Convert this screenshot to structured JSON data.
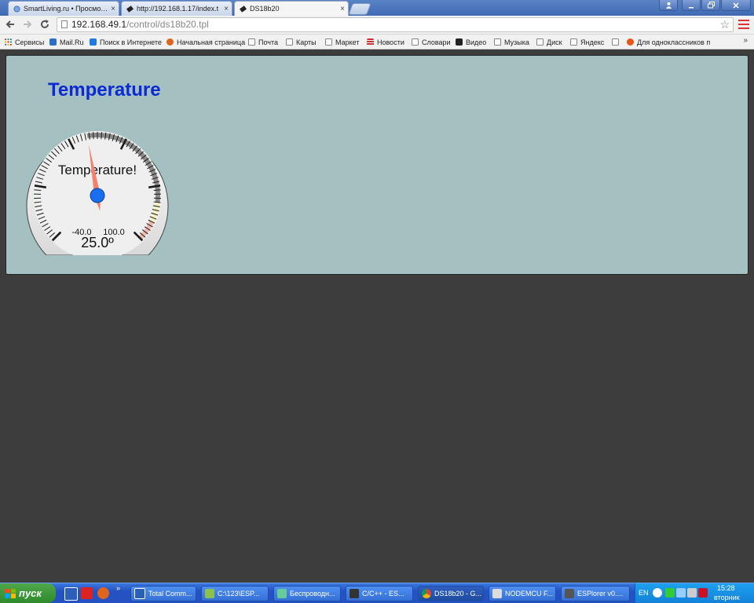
{
  "browser": {
    "tabs": [
      {
        "label": "SmartLiving.ru • Просмотр т",
        "active": false
      },
      {
        "label": "http://192.168.1.17/index.t",
        "active": false
      },
      {
        "label": "DS18b20",
        "active": true
      }
    ],
    "tab_close_glyph": "×",
    "address": {
      "host": "192.168.49.1",
      "path": "/control/ds18b20.tpl"
    },
    "bookmarks": [
      {
        "label": "Сервисы",
        "icon": "apps-grid-icon"
      },
      {
        "label": "Mail.Ru",
        "icon": "mailru-icon"
      },
      {
        "label": "Поиск в Интернете",
        "icon": "search-engine-icon"
      },
      {
        "label": "Начальная страница",
        "icon": "firefox-icon"
      },
      {
        "label": "Почта",
        "icon": "page-icon"
      },
      {
        "label": "Карты",
        "icon": "page-icon"
      },
      {
        "label": "Маркет",
        "icon": "page-icon"
      },
      {
        "label": "Новости",
        "icon": "news-icon"
      },
      {
        "label": "Словари",
        "icon": "page-icon"
      },
      {
        "label": "Видео",
        "icon": "video-icon"
      },
      {
        "label": "Музыка",
        "icon": "page-icon"
      },
      {
        "label": "Диск",
        "icon": "page-icon"
      },
      {
        "label": "Яндекс",
        "icon": "page-icon"
      },
      {
        "label": "",
        "icon": "page-icon"
      },
      {
        "label": "Для одноклассников п",
        "icon": "ok-icon"
      }
    ],
    "bookmarks_more": "»"
  },
  "page": {
    "title": "Temperature",
    "gauge": {
      "label": "Temperature!",
      "min": -40.0,
      "max": 100.0,
      "min_label": "-40.0",
      "max_label": "100.0",
      "value": 25.0,
      "value_label": "25.0º",
      "colors": {
        "needle": "#f4826a",
        "hub": "#1a6ff0",
        "yellow_band": "#f5f0c0",
        "red_band": "#f1b8b0"
      }
    }
  },
  "taskbar": {
    "start_label": "пуск",
    "tasks": [
      {
        "label": "Total Comm...",
        "active": false
      },
      {
        "label": "C:\\123\\ESP...",
        "active": false
      },
      {
        "label": "Беспроводн...",
        "active": false
      },
      {
        "label": "C/C++ - ES...",
        "active": false
      },
      {
        "label": "DS18b20 - G...",
        "active": true
      },
      {
        "label": "NODEMCU F...",
        "active": false
      },
      {
        "label": "ESPlorer v0....",
        "active": false
      }
    ],
    "lang": "EN",
    "clock_time": "15:28",
    "clock_day": "вторник"
  }
}
